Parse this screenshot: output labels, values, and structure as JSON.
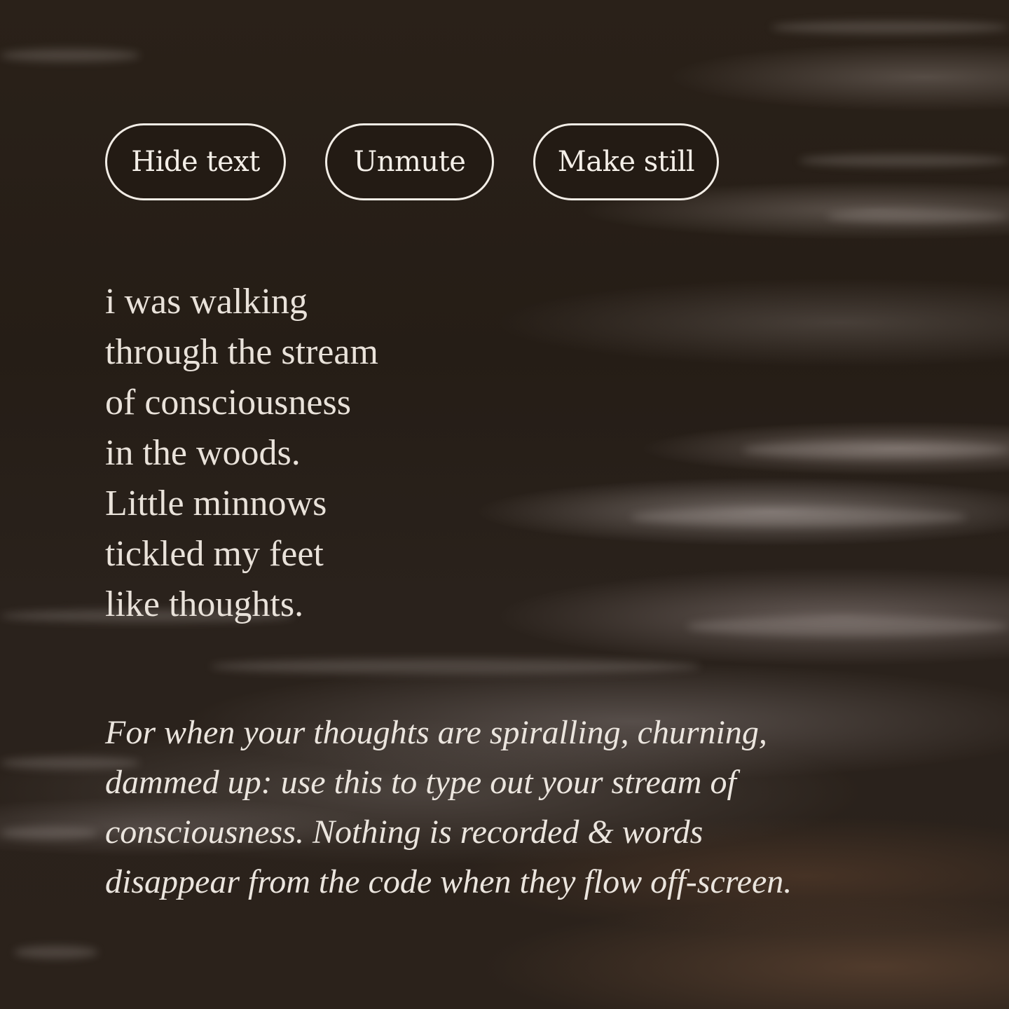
{
  "controls": {
    "hide_text_label": "Hide text",
    "unmute_label": "Unmute",
    "make_still_label": "Make still"
  },
  "poem": {
    "lines": [
      "i was walking",
      "through the stream",
      "of consciousness",
      "in the woods.",
      "Little minnows",
      "tickled my feet",
      "like thoughts."
    ]
  },
  "note": {
    "text": "For when your thoughts are spiralling, churning, dammed up: use this to type out your stream of consciousness. Nothing is recorded & words disappear from the code when they flow off-screen."
  },
  "colors": {
    "background": "#241c15",
    "text": "#e9e2da",
    "button_border": "#f2ede6"
  }
}
